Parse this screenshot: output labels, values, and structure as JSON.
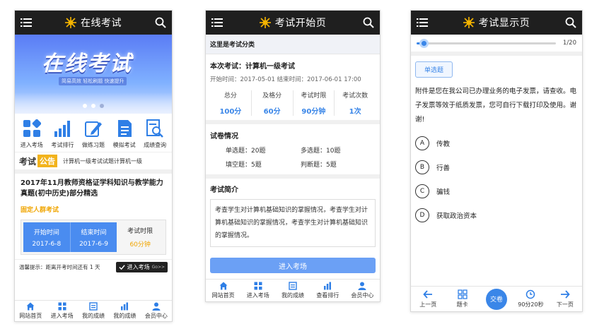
{
  "phone1": {
    "title": "在线考试",
    "banner": {
      "headline": "在线考试",
      "subline": "简易高效 轻松刷题 快速提升"
    },
    "icons": [
      {
        "label": "进入考场",
        "icon": "grid-icon"
      },
      {
        "label": "考试排行",
        "icon": "bar-chart-icon"
      },
      {
        "label": "做练习题",
        "icon": "pencil-icon"
      },
      {
        "label": "模拟考试",
        "icon": "document-icon"
      },
      {
        "label": "成绩查询",
        "icon": "search-doc-icon"
      }
    ],
    "notice": {
      "label1": "考试",
      "label2": "公告",
      "text": "计算机一级考试试题计算机一级"
    },
    "card": {
      "title": "2017年11月教师资格证学科知识与教学能力真题(初中历史)部分精选",
      "tag": "固定人群考试",
      "start_label": "开始时间",
      "start_value": "2017-6-8",
      "end_label": "结束时间",
      "end_value": "2017-6-9",
      "limit_label": "考试时限",
      "limit_value": "60分钟"
    },
    "remind": {
      "text": "温馨提示：距离开考时间还有 1 天",
      "button": "进入考场",
      "badge": "Go>>"
    },
    "tabs": [
      "网站首页",
      "进入考场",
      "我的成绩",
      "我的成绩",
      "会员中心"
    ]
  },
  "phone2": {
    "title": "考试开始页",
    "section": "这里是考试分类",
    "exam_name": "本次考试：计算机一级考试",
    "dates": "开始时间：2017-05-01    结束时间：2017-06-01 17:00",
    "stats": [
      {
        "label": "总分",
        "value": "100分"
      },
      {
        "label": "及格分",
        "value": "60分"
      },
      {
        "label": "考试时限",
        "value": "90分钟"
      },
      {
        "label": "考试次数",
        "value": "1次"
      }
    ],
    "paper_head": "试卷情况",
    "paper": [
      "单选题：20题",
      "多选题：10题",
      "填空题：5题",
      "判断题：5题"
    ],
    "intro_head": "考试简介",
    "intro": "考查学生对计算机基础知识的掌握情况，考查学生对计算机基础知识的掌握情况，考查学生对计算机基础知识的掌握情况。",
    "enter_button": "进入考场",
    "tabs": [
      "网站首页",
      "进入考场",
      "我的成绩",
      "查看排行",
      "会员中心"
    ]
  },
  "phone3": {
    "title": "考试显示页",
    "progress": {
      "current": 1,
      "total": 20,
      "text": "1/20"
    },
    "qtype": "单选题",
    "question": "附件是您在我公司已办理业务的电子发票，请查收。电子发票等效于纸质发票，您可自行下载打印及使用。谢谢!",
    "options": [
      {
        "letter": "A",
        "text": "传教"
      },
      {
        "letter": "B",
        "text": "行善"
      },
      {
        "letter": "C",
        "text": "骗钱"
      },
      {
        "letter": "D",
        "text": "获取政治资本"
      }
    ],
    "bottom": {
      "prev": "上一页",
      "card": "题卡",
      "submit": "交卷",
      "timer": "90分20秒",
      "next": "下一页"
    }
  },
  "colors": {
    "topbar": "#1f1f1f",
    "accent": "#3a86e8",
    "gold": "#f0a500"
  }
}
